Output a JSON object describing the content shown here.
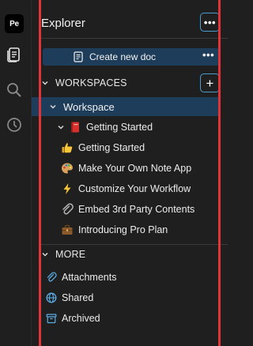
{
  "app": {
    "logo_text": "Pe"
  },
  "explorer": {
    "title": "Explorer",
    "more_label": "•••"
  },
  "create": {
    "label": "Create new doc",
    "more_label": "•••"
  },
  "workspaces": {
    "header": "WORKSPACES",
    "add_label": "+",
    "workspace": {
      "label": "Workspace"
    },
    "items": [
      {
        "label": "Getting Started",
        "icon": "red-book-icon",
        "expanded": true
      },
      {
        "label": "Getting Started",
        "icon": "thumbs-up-icon"
      },
      {
        "label": "Make Your Own Note App",
        "icon": "palette-icon"
      },
      {
        "label": "Customize Your Workflow",
        "icon": "lightning-icon"
      },
      {
        "label": "Embed 3rd Party Contents",
        "icon": "paperclip-icon"
      },
      {
        "label": "Introducing Pro Plan",
        "icon": "briefcase-icon"
      }
    ]
  },
  "more": {
    "header": "MORE",
    "items": [
      {
        "label": "Attachments",
        "icon": "attachment-icon"
      },
      {
        "label": "Shared",
        "icon": "globe-icon"
      },
      {
        "label": "Archived",
        "icon": "archive-icon"
      }
    ]
  },
  "colors": {
    "background": "#1f1f1f",
    "selection": "#1e3d5a",
    "accent_border": "#4a9ccf",
    "annotation_red": "#e0343b",
    "icon_blue": "#5aaee6"
  }
}
